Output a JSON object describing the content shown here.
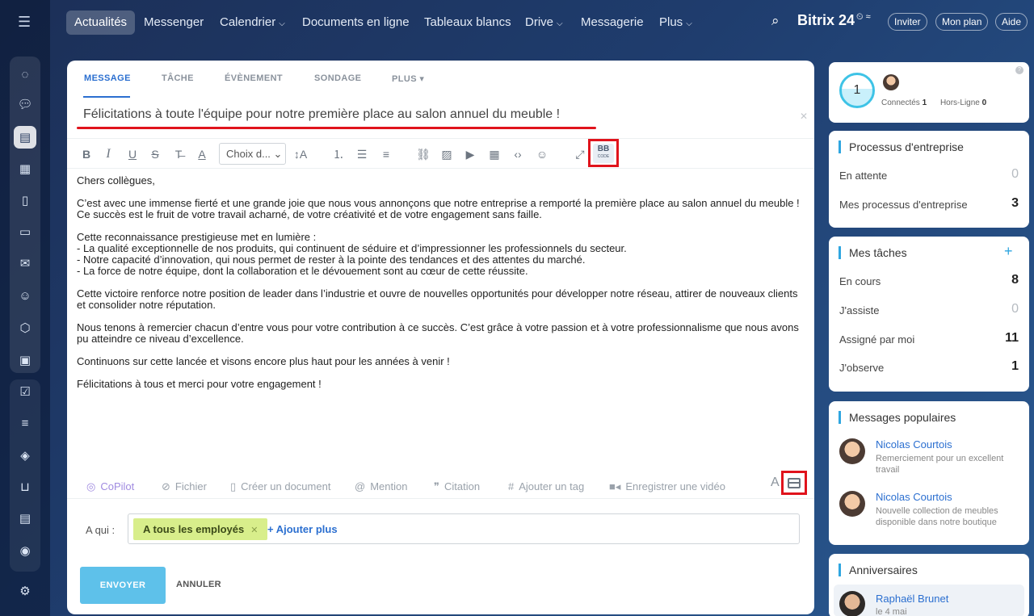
{
  "nav": {
    "items": [
      {
        "label": "Actualités",
        "active": true
      },
      {
        "label": "Messenger"
      },
      {
        "label": "Calendrier",
        "caret": true
      },
      {
        "label": "Documents en ligne"
      },
      {
        "label": "Tableaux blancs"
      },
      {
        "label": "Drive",
        "caret": true
      },
      {
        "label": "Messagerie"
      },
      {
        "label": "Plus",
        "caret": true
      }
    ],
    "brand": "Bitrix 24",
    "invite": "Inviter",
    "plan": "Mon plan",
    "help": "Aide"
  },
  "composer": {
    "tabs": [
      "MESSAGE",
      "TÂCHE",
      "ÉVÈNEMENT",
      "SONDAGE",
      "PLUS"
    ],
    "title": "Félicitations à toute l'équipe pour notre première place au salon annuel du meuble !",
    "font_select": "Choix d...",
    "bbcode_label": "BB",
    "bbcode_sub": "CODE",
    "paragraphs": [
      "Chers collègues,",
      "C’est avec une immense fierté et une grande joie que nous vous annonçons que notre entreprise a remporté la première place au salon annuel du meuble ! Ce succès est le fruit de votre travail acharné, de votre créativité et de votre engagement sans faille.",
      "Cette reconnaissance prestigieuse met en lumière :\n- La qualité exceptionnelle de nos produits, qui continuent de séduire et d’impressionner les professionnels du secteur.\n- Notre capacité d’innovation, qui nous permet de rester à la pointe des tendances et des attentes du marché.\n- La force de notre équipe, dont la collaboration et le dévouement sont au cœur de cette réussite.",
      "Cette victoire renforce notre position de leader dans l’industrie et ouvre de nouvelles opportunités pour développer notre réseau, attirer de nouveaux clients et consolider notre réputation.",
      "Nous tenons à remercier chacun d’entre vous pour votre contribution à ce succès. C’est grâce à votre passion et à votre professionnalisme que nous avons pu atteindre ce niveau d’excellence.",
      "Continuons sur cette lancée et visons encore plus haut pour les années à venir !",
      "Félicitations à tous et merci pour votre engagement !"
    ],
    "bottom": {
      "copilot": "CoPilot",
      "file": "Fichier",
      "create_doc": "Créer un document",
      "mention": "Mention",
      "quote": "Citation",
      "tag": "Ajouter un tag",
      "video": "Enregistrer une vidéo",
      "font_toggle": "A"
    },
    "recipients_label": "A qui :",
    "recipient_chip": "A tous les employés",
    "add_more": "+ Ajouter plus",
    "send": "ENVOYER",
    "cancel": "ANNULER"
  },
  "sidebar": {
    "online": {
      "count": "1",
      "connected_label": "Connectés",
      "connected": "1",
      "offline_label": "Hors-Ligne",
      "offline": "0"
    },
    "processes": {
      "title": "Processus d'entreprise",
      "rows": [
        {
          "label": "En attente",
          "value": "0"
        },
        {
          "label": "Mes processus d'entreprise",
          "value": "3"
        }
      ]
    },
    "tasks": {
      "title": "Mes tâches",
      "rows": [
        {
          "label": "En cours",
          "value": "8"
        },
        {
          "label": "J'assiste",
          "value": "0"
        },
        {
          "label": "Assigné par moi",
          "value": "11"
        },
        {
          "label": "J'observe",
          "value": "1"
        }
      ]
    },
    "popular": {
      "title": "Messages populaires",
      "posts": [
        {
          "author": "Nicolas Courtois",
          "text": "Remerciement pour un excellent travail"
        },
        {
          "author": "Nicolas Courtois",
          "text": "Nouvelle collection de meubles disponible dans notre boutique"
        }
      ]
    },
    "birthdays": {
      "title": "Anniversaires",
      "name": "Raphaël Brunet",
      "date": "le 4 mai"
    }
  },
  "colors": {
    "accent": "#2b6fd0",
    "highlight": "#e0131c",
    "send": "#5ec1ea",
    "chip": "#d8ee8b"
  }
}
